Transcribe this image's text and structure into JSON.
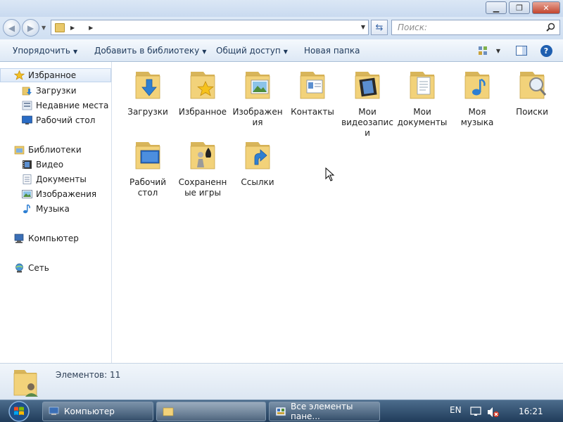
{
  "window": {
    "controls": [
      "minimize",
      "maximize",
      "close"
    ]
  },
  "nav": {
    "address_path": "",
    "search_placeholder": "Поиск:"
  },
  "toolbar": {
    "organize": "Упорядочить",
    "add_to_library": "Добавить в библиотеку",
    "share": "Общий доступ",
    "new_folder": "Новая папка"
  },
  "sidebar": {
    "favorites": {
      "label": "Избранное",
      "icon": "star-icon",
      "items": [
        {
          "label": "Загрузки",
          "icon": "downloads-icon"
        },
        {
          "label": "Недавние места",
          "icon": "recent-places-icon"
        },
        {
          "label": "Рабочий стол",
          "icon": "desktop-icon"
        }
      ]
    },
    "libraries": {
      "label": "Библиотеки",
      "icon": "libraries-icon",
      "items": [
        {
          "label": "Видео",
          "icon": "video-icon"
        },
        {
          "label": "Документы",
          "icon": "documents-icon"
        },
        {
          "label": "Изображения",
          "icon": "pictures-icon"
        },
        {
          "label": "Музыка",
          "icon": "music-icon"
        }
      ]
    },
    "computer": {
      "label": "Компьютер",
      "icon": "computer-icon"
    },
    "network": {
      "label": "Сеть",
      "icon": "network-icon"
    }
  },
  "folders": [
    {
      "label": "Загрузки",
      "icon": "downloads-folder-icon"
    },
    {
      "label": "Избранное",
      "icon": "favorites-folder-icon"
    },
    {
      "label": "Изображения",
      "icon": "pictures-folder-icon"
    },
    {
      "label": "Контакты",
      "icon": "contacts-folder-icon"
    },
    {
      "label": "Мои видеозаписи",
      "icon": "videos-folder-icon"
    },
    {
      "label": "Мои документы",
      "icon": "documents-folder-icon"
    },
    {
      "label": "Моя музыка",
      "icon": "music-folder-icon"
    },
    {
      "label": "Поиски",
      "icon": "searches-folder-icon"
    },
    {
      "label": "Рабочий стол",
      "icon": "desktop-folder-icon"
    },
    {
      "label": "Сохраненные игры",
      "icon": "saved-games-folder-icon"
    },
    {
      "label": "Ссылки",
      "icon": "links-folder-icon"
    }
  ],
  "details": {
    "item_count": "Элементов: 11"
  },
  "taskbar": {
    "tasks": [
      {
        "label": "Компьютер",
        "icon": "computer-icon"
      },
      {
        "label": "",
        "icon": "folder-icon"
      },
      {
        "label": "Все элементы пане...",
        "icon": "control-panel-icon"
      }
    ],
    "language": "EN",
    "time": "16:21"
  },
  "colors": {
    "folder_yellow": "#f2d27a",
    "taskbar_bg": "#2f4c6c",
    "toolbar_text": "#1e395b"
  }
}
